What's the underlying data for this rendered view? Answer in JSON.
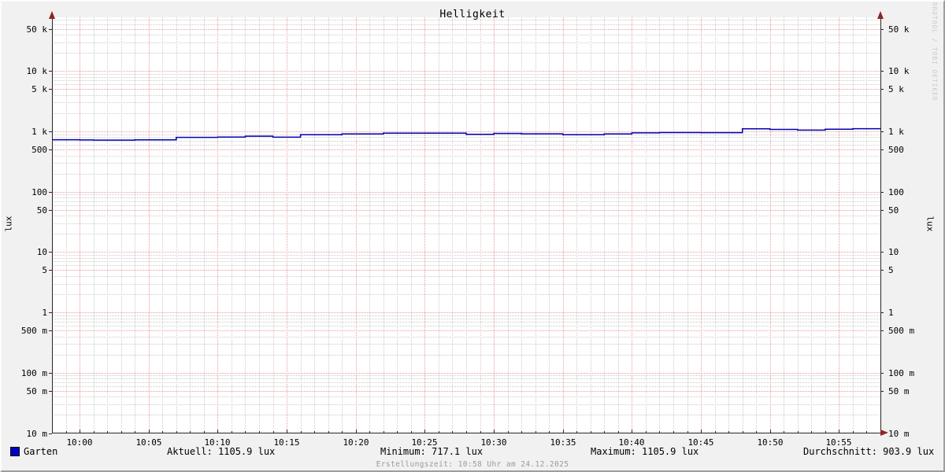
{
  "title": "Helligkeit",
  "watermark": "RRDTOOL / TOBI OETIKER",
  "y_axis_left_label": "lux",
  "y_axis_right_label": "lux",
  "y_ticks": [
    {
      "label": "50 k",
      "value": 50000
    },
    {
      "label": "10 k",
      "value": 10000
    },
    {
      "label": "5 k",
      "value": 5000
    },
    {
      "label": "1 k",
      "value": 1000
    },
    {
      "label": "500",
      "value": 500
    },
    {
      "label": "100",
      "value": 100
    },
    {
      "label": "50",
      "value": 50
    },
    {
      "label": "10",
      "value": 10
    },
    {
      "label": "5",
      "value": 5
    },
    {
      "label": "1",
      "value": 1
    },
    {
      "label": "500 m",
      "value": 0.5
    },
    {
      "label": "100 m",
      "value": 0.1
    },
    {
      "label": "50 m",
      "value": 0.05
    },
    {
      "label": "10 m",
      "value": 0.01
    }
  ],
  "x_ticks": [
    {
      "label": "10:00",
      "minute": 2
    },
    {
      "label": "10:05",
      "minute": 7
    },
    {
      "label": "10:10",
      "minute": 12
    },
    {
      "label": "10:15",
      "minute": 17
    },
    {
      "label": "10:20",
      "minute": 22
    },
    {
      "label": "10:25",
      "minute": 27
    },
    {
      "label": "10:30",
      "minute": 32
    },
    {
      "label": "10:35",
      "minute": 37
    },
    {
      "label": "10:40",
      "minute": 42
    },
    {
      "label": "10:45",
      "minute": 47
    },
    {
      "label": "10:50",
      "minute": 52
    },
    {
      "label": "10:55",
      "minute": 57
    }
  ],
  "legend": {
    "label": "Garten",
    "color": "#0000c8"
  },
  "stats": {
    "aktuell": "Aktuell: 1105.9 lux",
    "minimum": "Minimum: 717.1 lux",
    "maximum": "Maximum: 1105.9 lux",
    "durchschnitt": "Durchschnitt: 903.9 lux"
  },
  "footer": "Erstellungszeit: 10:58 Uhr am 24.12.2025",
  "colors": {
    "line": "#0000b0",
    "legend_swatch": "#0000c8",
    "grid_major": "#ef9a9a",
    "grid_minor": "#cccccc",
    "axis": "#262626",
    "arrow": "#8f2525",
    "background": "#f1f1f1",
    "canvas": "#ffffff",
    "footer_text": "#9a9a9a",
    "watermark_text": "#c9c9c9"
  },
  "chart_data": {
    "type": "line",
    "title": "Helligkeit",
    "xlabel": "",
    "ylabel": "lux",
    "y_scale": "log",
    "ylim": [
      0.01,
      77000
    ],
    "x_start": "09:58",
    "x_end": "10:58",
    "x_tick_labels": [
      "10:00",
      "10:05",
      "10:10",
      "10:15",
      "10:20",
      "10:25",
      "10:30",
      "10:35",
      "10:40",
      "10:45",
      "10:50",
      "10:55"
    ],
    "grid": true,
    "legend_position": "bottom-left",
    "series": [
      {
        "name": "Garten",
        "color": "#0000b0",
        "unit": "lux",
        "interpolation": "step-after",
        "step_points": [
          [
            "09:58",
            728
          ],
          [
            "10:00",
            722
          ],
          [
            "10:01",
            717.1
          ],
          [
            "10:04",
            726
          ],
          [
            "10:07",
            795
          ],
          [
            "10:10",
            806
          ],
          [
            "10:12",
            833
          ],
          [
            "10:14",
            800
          ],
          [
            "10:16",
            878
          ],
          [
            "10:19",
            905
          ],
          [
            "10:22",
            935
          ],
          [
            "10:28",
            895
          ],
          [
            "10:30",
            925
          ],
          [
            "10:32",
            912
          ],
          [
            "10:35",
            880
          ],
          [
            "10:38",
            905
          ],
          [
            "10:40",
            945
          ],
          [
            "10:42",
            955
          ],
          [
            "10:45",
            952
          ],
          [
            "10:48",
            1100
          ],
          [
            "10:50",
            1078
          ],
          [
            "10:52",
            1048
          ],
          [
            "10:54",
            1085
          ],
          [
            "10:56",
            1105.9
          ]
        ]
      }
    ],
    "stats": {
      "aktuell_lux": 1105.9,
      "minimum_lux": 717.1,
      "maximum_lux": 1105.9,
      "durchschnitt_lux": 903.9
    }
  }
}
